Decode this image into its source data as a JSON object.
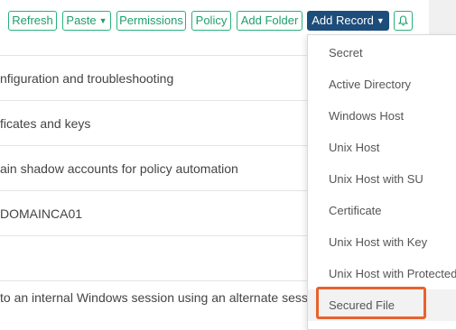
{
  "toolbar": {
    "refresh": "Refresh",
    "paste": "Paste",
    "permissions": "Permissions",
    "policy": "Policy",
    "add_folder": "Add Folder",
    "add_record": "Add Record"
  },
  "rows": [
    "nfiguration and troubleshooting",
    "ficates and keys",
    "ain shadow accounts for policy automation",
    "DOMAINCA01",
    "",
    "to an internal Windows session using an alternate session"
  ],
  "add_record_menu": [
    "Secret",
    "Active Directory",
    "Windows Host",
    "Unix Host",
    "Unix Host with SU",
    "Certificate",
    "Unix Host with Key",
    "Unix Host with Protected",
    "Secured File"
  ],
  "colors": {
    "accent_green": "#2bb07f",
    "primary_blue": "#1d4d7a",
    "highlight_orange": "#e8622c"
  }
}
